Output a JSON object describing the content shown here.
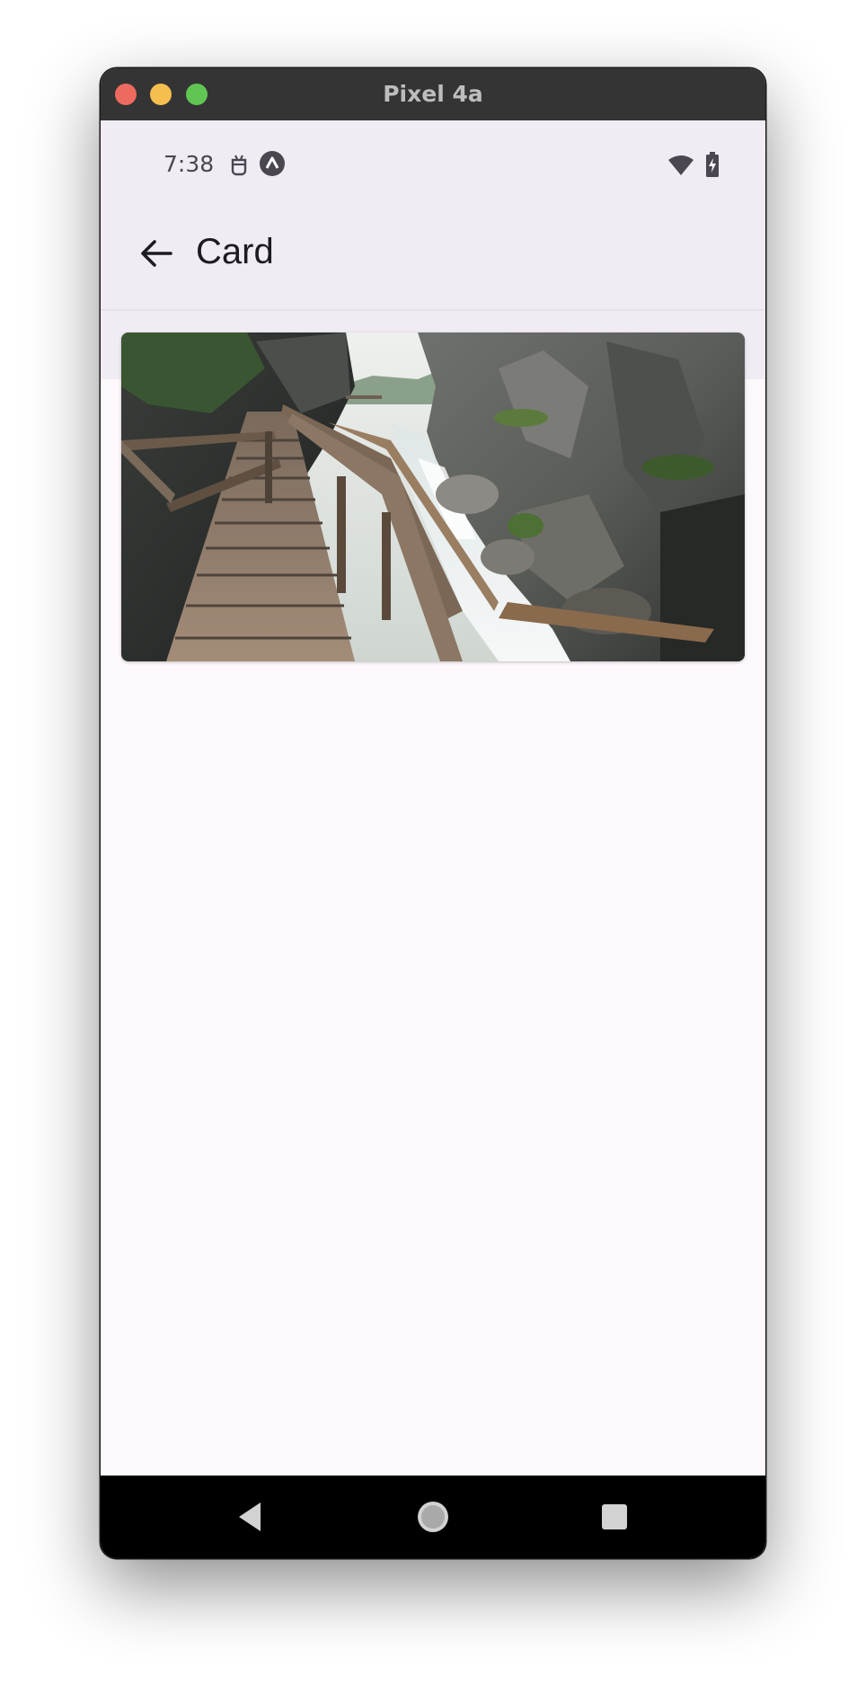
{
  "window": {
    "title": "Pixel 4a"
  },
  "status_bar": {
    "time": "7:38",
    "icons": [
      "android-debug-icon",
      "app-notification-icon",
      "wifi-icon",
      "battery-charging-icon"
    ]
  },
  "app_bar": {
    "title": "Card",
    "back_icon": "arrow-back-icon"
  },
  "card": {
    "image_description_icon": "landscape-image",
    "image_alt": ""
  },
  "nav_bar": {
    "buttons": [
      "back-triangle-icon",
      "home-circle-icon",
      "recents-square-icon"
    ]
  },
  "colors": {
    "app_bar_bg": "#f1ecf4",
    "page_bg": "#fdf8fc",
    "title_text": "#1c1b1f",
    "nav_bar_bg": "#000000"
  }
}
